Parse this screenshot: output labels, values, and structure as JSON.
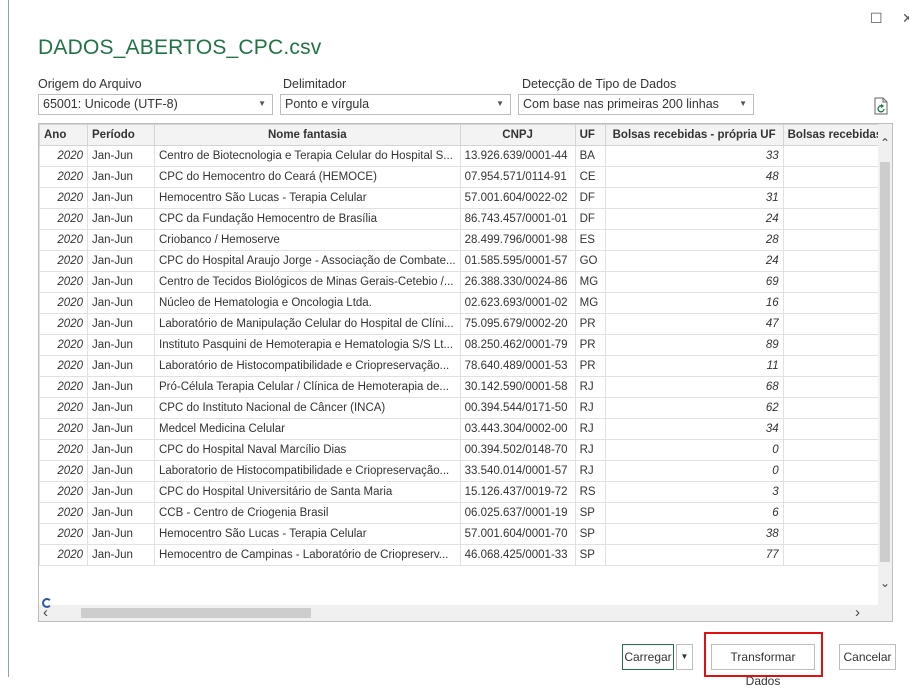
{
  "window": {
    "title": "DADOS_ABERTOS_CPC.csv",
    "maximize_glyph": "☐",
    "close_glyph": "✕"
  },
  "options": {
    "origin_label": "Origem do Arquivo",
    "origin_value": "65001: Unicode (UTF-8)",
    "delimiter_label": "Delimitador",
    "delimiter_value": "Ponto e vírgula",
    "detection_label": "Detecção de Tipo de Dados",
    "detection_value": "Com base nas primeiras 200 linhas"
  },
  "icons": {
    "refresh": "refresh-document-icon",
    "dropdown": "chevron-down-icon"
  },
  "table": {
    "columns": [
      "Ano",
      "Período",
      "Nome fantasia",
      "CNPJ",
      "UF",
      "Bolsas recebidas - própria UF",
      "Bolsas recebidas"
    ],
    "rows": [
      [
        "2020",
        "Jan-Jun",
        "Centro de Biotecnologia e Terapia Celular do Hospital S...",
        "13.926.639/0001-44",
        "BA",
        "33"
      ],
      [
        "2020",
        "Jan-Jun",
        "CPC do Hemocentro do Ceará (HEMOCE)",
        "07.954.571/0114-91",
        "CE",
        "48"
      ],
      [
        "2020",
        "Jan-Jun",
        "Hemocentro São Lucas - Terapia Celular",
        "57.001.604/0022-02",
        "DF",
        "31"
      ],
      [
        "2020",
        "Jan-Jun",
        "CPC da Fundação Hemocentro de Brasília",
        "86.743.457/0001-01",
        "DF",
        "24"
      ],
      [
        "2020",
        "Jan-Jun",
        "Criobanco / Hemoserve",
        "28.499.796/0001-98",
        "ES",
        "28"
      ],
      [
        "2020",
        "Jan-Jun",
        "CPC do Hospital Araujo Jorge - Associação de Combate...",
        "01.585.595/0001-57",
        "GO",
        "24"
      ],
      [
        "2020",
        "Jan-Jun",
        "Centro de Tecidos Biológicos de Minas Gerais-Cetebio /...",
        "26.388.330/0024-86",
        "MG",
        "69"
      ],
      [
        "2020",
        "Jan-Jun",
        "Núcleo de Hematologia e Oncologia Ltda.",
        "02.623.693/0001-02",
        "MG",
        "16"
      ],
      [
        "2020",
        "Jan-Jun",
        "Laboratório de Manipulação Celular do Hospital de Clíni...",
        "75.095.679/0002-20",
        "PR",
        "47"
      ],
      [
        "2020",
        "Jan-Jun",
        "Instituto Pasquini de Hemoterapia e Hematologia S/S Lt...",
        "08.250.462/0001-79",
        "PR",
        "89"
      ],
      [
        "2020",
        "Jan-Jun",
        "Laboratório de Histocompatibilidade e Criopreservação...",
        "78.640.489/0001-53",
        "PR",
        "11"
      ],
      [
        "2020",
        "Jan-Jun",
        "Pró-Célula Terapia Celular / Clínica de Hemoterapia de...",
        "30.142.590/0001-58",
        "RJ",
        "68"
      ],
      [
        "2020",
        "Jan-Jun",
        "CPC do Instituto Nacional de Câncer (INCA)",
        "00.394.544/0171-50",
        "RJ",
        "62"
      ],
      [
        "2020",
        "Jan-Jun",
        "Medcel Medicina Celular",
        "03.443.304/0002-00",
        "RJ",
        "34"
      ],
      [
        "2020",
        "Jan-Jun",
        "CPC do Hospital Naval Marcílio Dias",
        "00.394.502/0148-70",
        "RJ",
        "0"
      ],
      [
        "2020",
        "Jan-Jun",
        "Laboratorio de Histocompatibilidade e Criopreservação...",
        "33.540.014/0001-57",
        "RJ",
        "0"
      ],
      [
        "2020",
        "Jan-Jun",
        "CPC do Hospital Universitário de Santa Maria",
        "15.126.437/0019-72",
        "RS",
        "3"
      ],
      [
        "2020",
        "Jan-Jun",
        "CCB - Centro de Criogenia Brasil",
        "06.025.637/0001-19",
        "SP",
        "6"
      ],
      [
        "2020",
        "Jan-Jun",
        "Hemocentro São Lucas - Terapia Celular",
        "57.001.604/0001-70",
        "SP",
        "38"
      ],
      [
        "2020",
        "Jan-Jun",
        "Hemocentro de Campinas - Laboratório de Criopreserv...",
        "46.068.425/0001-33",
        "SP",
        "77"
      ]
    ]
  },
  "buttons": {
    "load": "Carregar",
    "transform": "Transformar Dados",
    "cancel": "Cancelar"
  },
  "colors": {
    "title": "#217346",
    "highlight": "#e01010"
  }
}
